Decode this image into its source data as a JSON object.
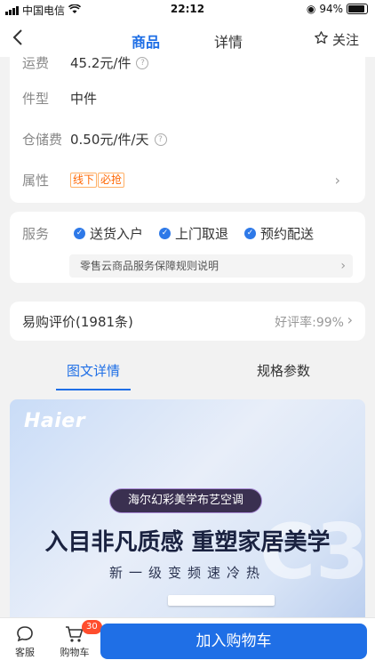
{
  "status_bar": {
    "carrier": "中国电信",
    "time": "22:12",
    "battery": "94%"
  },
  "nav": {
    "tabs": [
      "商品",
      "详情"
    ],
    "active_tab": "商品",
    "follow_label": "关注"
  },
  "product_info": {
    "freight": {
      "label": "运费",
      "value": "45.2元/件"
    },
    "size_type": {
      "label": "件型",
      "value": "中件"
    },
    "storage_fee": {
      "label": "仓储费",
      "value": "0.50元/件/天"
    },
    "attributes": {
      "label": "属性",
      "tags": [
        "线下",
        "必抢"
      ]
    }
  },
  "services": {
    "label": "服务",
    "items": [
      "送货入户",
      "上门取退",
      "预约配送"
    ],
    "guarantee_link": "零售云商品服务保障规则说明"
  },
  "reviews": {
    "title": "易购评价(1981条)",
    "rate": "好评率:99%"
  },
  "detail_tabs": {
    "tabs": [
      "图文详情",
      "规格参数"
    ],
    "active": "图文详情"
  },
  "banner": {
    "brand": "Haier",
    "pill": "海尔幻彩美学布艺空调",
    "headline": "入目非凡质感  重塑家居美学",
    "subtitle": "新一级变频速冷热",
    "ghost_text": "C3"
  },
  "bottom_bar": {
    "service_label": "客服",
    "cart_label": "购物车",
    "cart_count": "30",
    "add_to_cart": "加入购物车"
  },
  "colors": {
    "accent": "#1f6fe6",
    "tag": "#ff6600",
    "badge": "#ff4d2d"
  }
}
